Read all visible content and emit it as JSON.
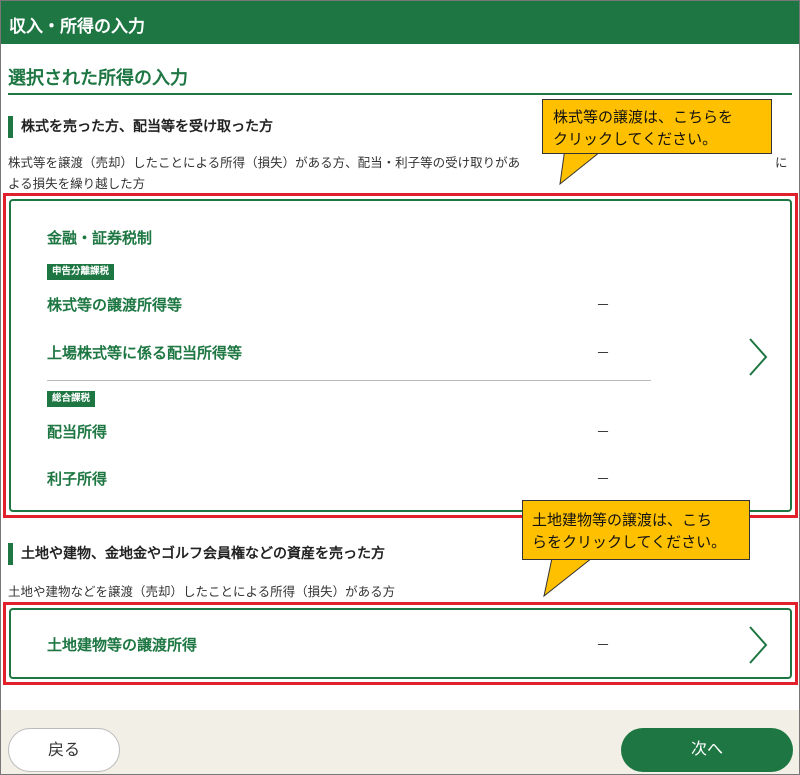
{
  "header": {
    "title": "収入・所得の入力"
  },
  "section": {
    "title": "選択された所得の入力"
  },
  "stocks": {
    "subhead": "株式を売った方、配当等を受け取った方",
    "desc_line1": "株式等を譲渡（売却）したことによる所得（損失）がある方、配当・利子等の受け取りがあ",
    "desc_line1_tail": "に",
    "desc_line2": "よる損失を繰り越した方",
    "card": {
      "heading": "金融・証券税制",
      "tag_separate": "申告分離課税",
      "tag_general": "総合課税",
      "rows": [
        {
          "label": "株式等の譲渡所得等",
          "value": "－"
        },
        {
          "label": "上場株式等に係る配当所得等",
          "value": "－"
        },
        {
          "label": "配当所得",
          "value": "－"
        },
        {
          "label": "利子所得",
          "value": "－"
        }
      ]
    }
  },
  "land": {
    "subhead": "土地や建物、金地金やゴルフ会員権などの資産を売った方",
    "desc": "土地や建物などを譲渡（売却）したことによる所得（損失）がある方",
    "card": {
      "label": "土地建物等の譲渡所得",
      "value": "－"
    }
  },
  "callouts": {
    "stocks_line1": "株式等の譲渡は、こちらを",
    "stocks_line2": "クリックしてください。",
    "land_line1": "土地建物等の譲渡は、こち",
    "land_line2": "らをクリックしてください。"
  },
  "footer": {
    "back_label": "戻る",
    "next_label": "次へ"
  },
  "colors": {
    "brand_green": "#1e7743",
    "highlight_red": "#e0202a",
    "callout_yellow": "#ffc000"
  }
}
